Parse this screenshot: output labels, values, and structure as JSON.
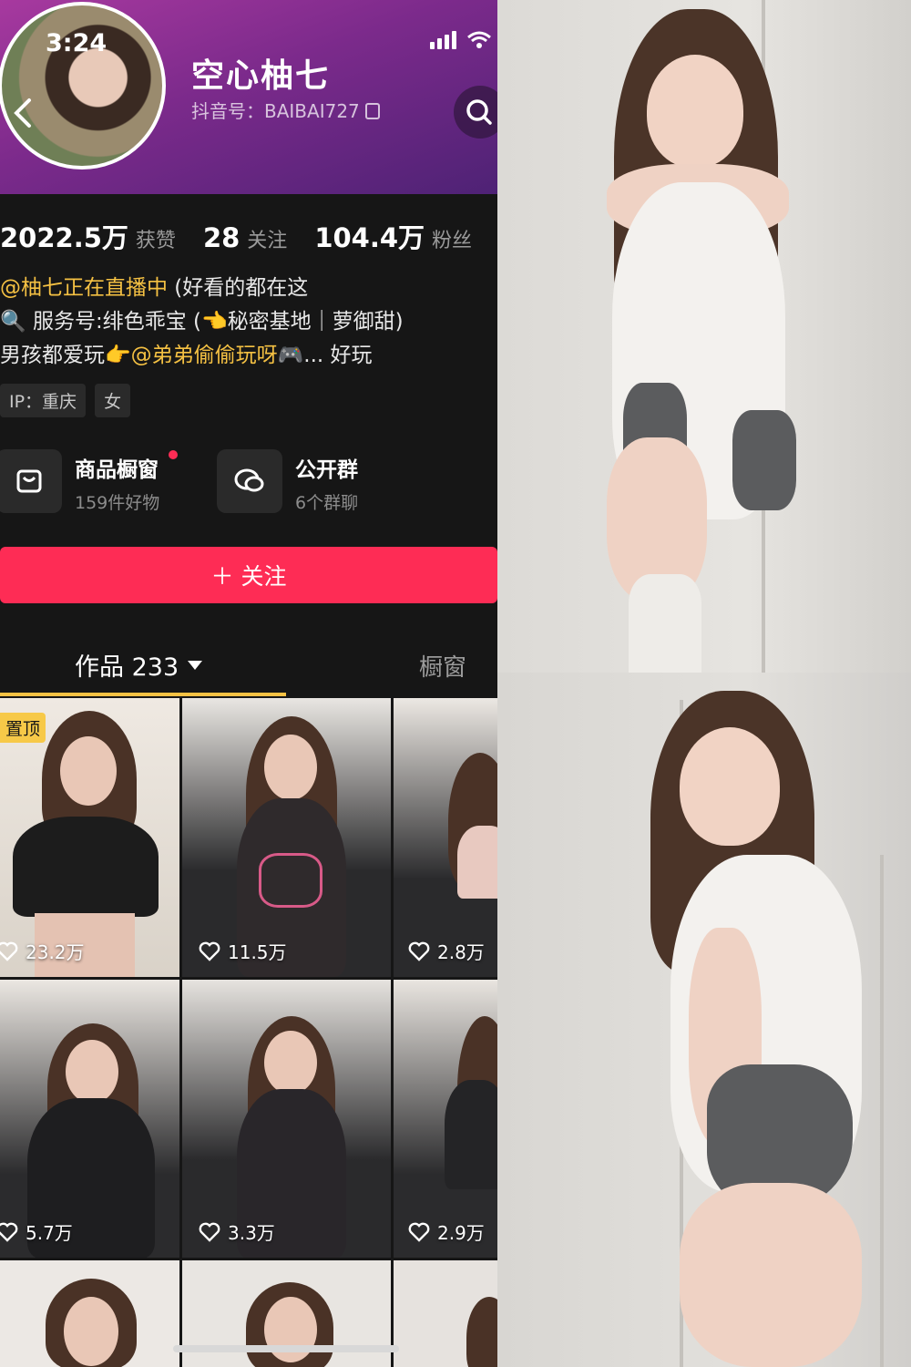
{
  "status_bar": {
    "time": "3:24"
  },
  "profile": {
    "name": "空心柚七",
    "account_id": "抖音号：BAIBAI727"
  },
  "stats": [
    {
      "value": "2022.5万",
      "label": "获赞"
    },
    {
      "value": "28",
      "label": "关注"
    },
    {
      "value": "104.4万",
      "label": "粉丝"
    }
  ],
  "bio": {
    "line1_link": "@柚七正在直播中",
    "line1_text": " (好看的都在这",
    "line2": "🔍 服务号:绯色乖宝 (👈秘密基地｜萝御甜)",
    "line3_text": "男孩都爱玩👉",
    "line3_link": "@弟弟偷偷玩呀",
    "line3_tail": "🎮... 好玩"
  },
  "tags": [
    "IP：重庆",
    "女"
  ],
  "entries": [
    {
      "title": "商品橱窗",
      "subtitle": "159件好物",
      "icon": "shopping-bag-icon"
    },
    {
      "title": "公开群",
      "subtitle": "6个群聊",
      "icon": "group-chat-icon"
    }
  ],
  "follow_button": "＋ 关注",
  "tabs": {
    "works": "作品 233",
    "showcase": "橱窗"
  },
  "grid": {
    "pin_label": "置顶",
    "items": [
      {
        "likes": "23.2万"
      },
      {
        "likes": "11.5万"
      },
      {
        "likes": "2.8万"
      },
      {
        "likes": "5.7万"
      },
      {
        "likes": "3.3万"
      },
      {
        "likes": "2.9万"
      }
    ]
  },
  "colors": {
    "accent": "#fe2c55",
    "link": "#f5c143",
    "background": "#161616"
  }
}
